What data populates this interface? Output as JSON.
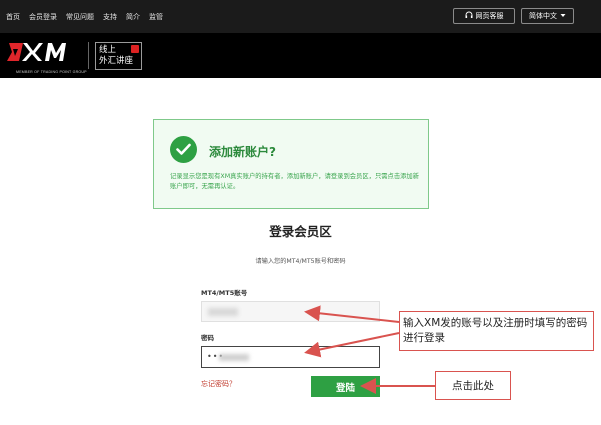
{
  "top_nav": {
    "items": [
      "首页",
      "会员登录",
      "常见问题",
      "支持",
      "简介",
      "监管"
    ],
    "support_label": "网页客服",
    "language_label": "简体中文"
  },
  "brand": {
    "logo_text": "XM",
    "logo_tagline": "MEMBER OF TRADING POINT GROUP",
    "badge_line1": "线上",
    "badge_line2": "外汇讲座"
  },
  "info_box": {
    "title": "添加新账户?",
    "text": "记录显示您是现有XM真实账户的持有者，添加新账户，请登录到会员区，只需点击添加新账户即可，无需再认证。"
  },
  "login": {
    "title": "登录会员区",
    "subtitle": "请输入您的MT4/MT5账号和密码",
    "account_label": "MT4/MT5账号",
    "password_label": "密码",
    "password_mask": "•••",
    "forgot_label": "忘记密码？",
    "submit_label": "登陆"
  },
  "annotations": {
    "note1": "输入XM发的账号以及注册时填写的密码进行登录",
    "note2": "点击此处"
  },
  "colors": {
    "accent_green": "#2ea043",
    "annotation_red": "#d9534f",
    "brand_red": "#e0262b"
  }
}
